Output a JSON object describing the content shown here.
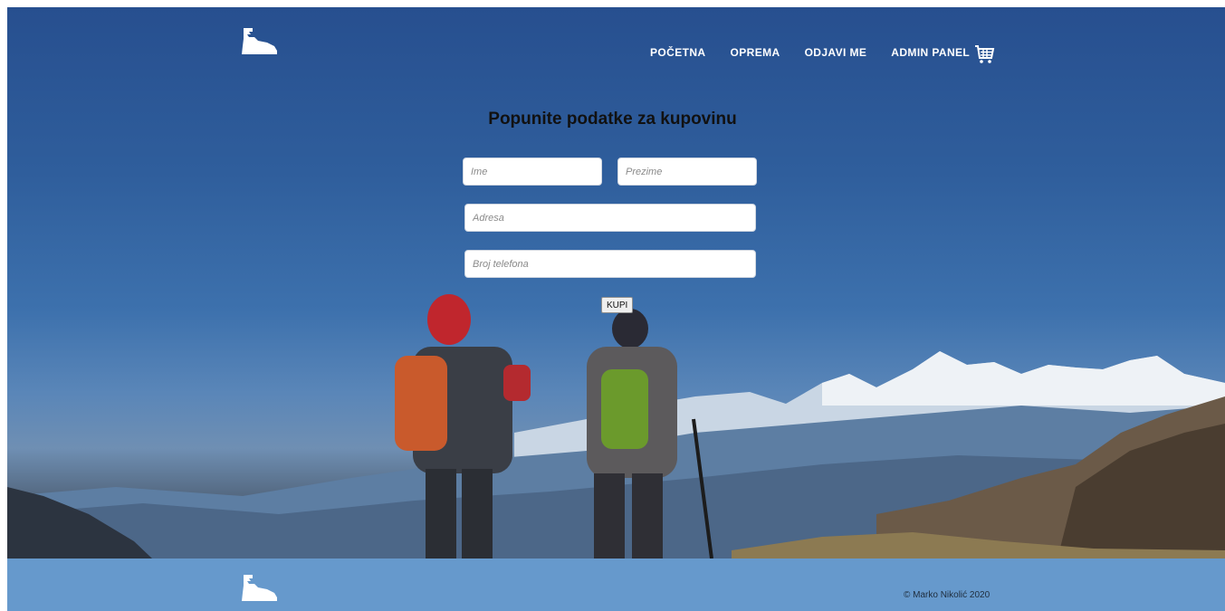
{
  "header": {
    "logo_icon": "hiking-boot-icon",
    "nav": [
      {
        "label": "POČETNA"
      },
      {
        "label": "OPREMA"
      },
      {
        "label": "ODJAVI ME"
      },
      {
        "label": "ADMIN PANEL"
      }
    ],
    "cart_icon": "shopping-cart-icon"
  },
  "form": {
    "title": "Popunite podatke za kupovinu",
    "fields": {
      "first_name": {
        "placeholder": "Ime",
        "value": ""
      },
      "last_name": {
        "placeholder": "Prezime",
        "value": ""
      },
      "address": {
        "placeholder": "Adresa",
        "value": ""
      },
      "phone": {
        "placeholder": "Broj telefona",
        "value": ""
      }
    },
    "submit_label": "KUPI"
  },
  "footer": {
    "logo_icon": "hiking-boot-icon",
    "copyright": "© Marko Nikolić 2020",
    "background_color": "#6699cc"
  }
}
